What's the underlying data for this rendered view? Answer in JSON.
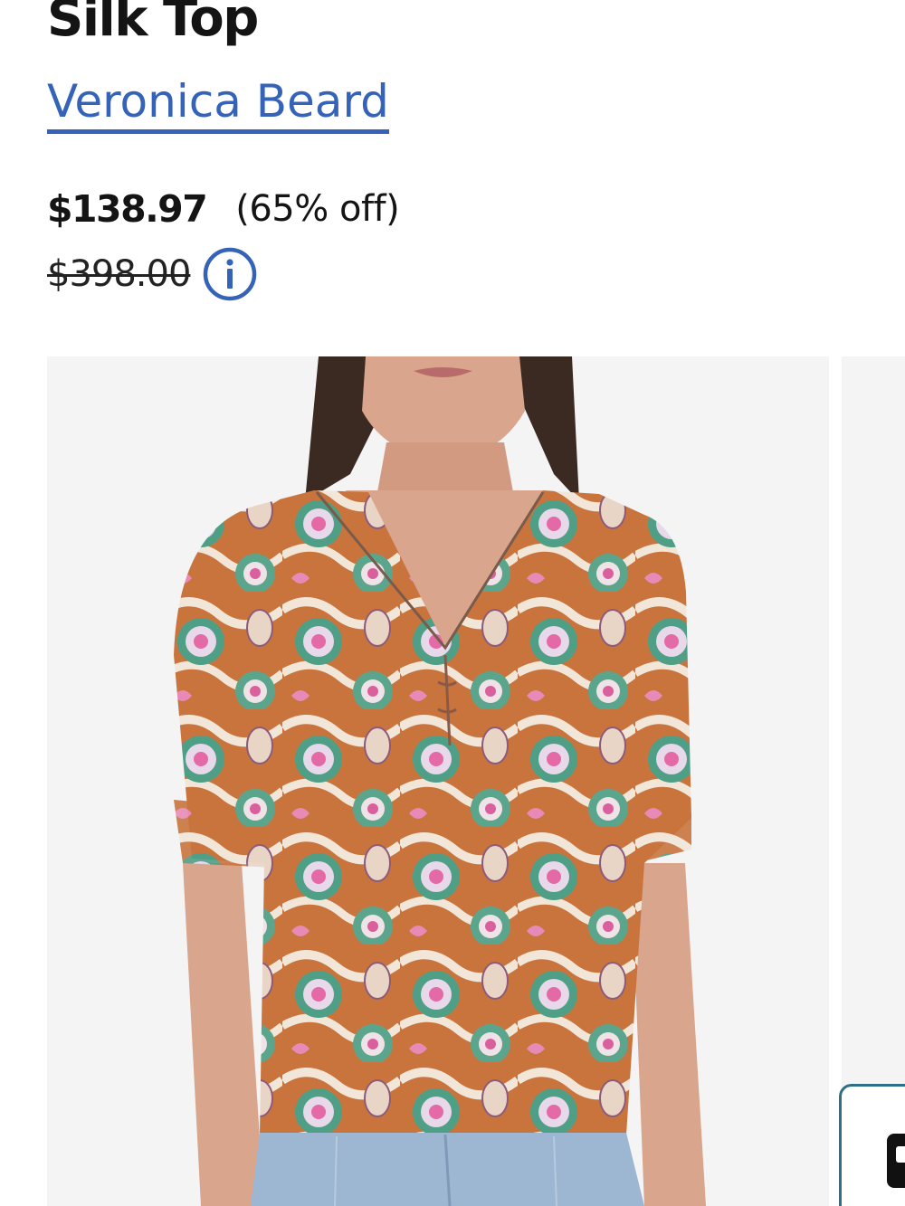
{
  "product": {
    "title": "Silk Top",
    "brand": "Veronica Beard",
    "sale_price": "$138.97",
    "discount": "(65% off)",
    "original_price": "$398.00"
  },
  "icons": {
    "info": "info-icon",
    "chat": "chat-icon"
  },
  "colors": {
    "link": "#3563b8",
    "text": "#141414",
    "image_bg": "#f4f4f5",
    "chat_border": "#2f6f86"
  }
}
